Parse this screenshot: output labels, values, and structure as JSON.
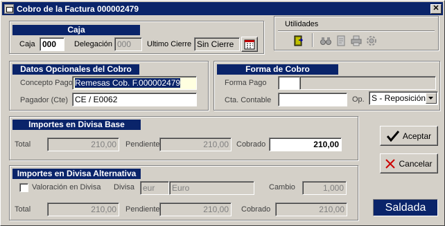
{
  "window": {
    "title": "Cobro de la Factura 000002479",
    "close_glyph": "✕"
  },
  "caja": {
    "title": "Caja",
    "caja_label": "Caja",
    "caja_value": "000",
    "delegacion_label": "Delegación",
    "delegacion_value": "000",
    "ultimo_cierre_label": "Ultimo Cierre",
    "ultimo_cierre_value": "Sin Cierre"
  },
  "utilidades": {
    "title": "Utilidades"
  },
  "datos": {
    "title": "Datos Opcionales del Cobro",
    "concepto_label": "Concepto Pago",
    "concepto_value": "Remesas Cob. F.000002479",
    "pagador_label": "Pagador (Cte)",
    "pagador_value": "CE / E0062"
  },
  "forma": {
    "title": "Forma de Cobro",
    "forma_pago_label": "Forma Pago",
    "forma_pago_code": "",
    "forma_pago_desc": "",
    "cta_contable_label": "Cta. Contable",
    "cta_contable_value": "",
    "op_label": "Op.",
    "op_value": "S - Reposición"
  },
  "base": {
    "title": "Importes en Divisa Base",
    "total_label": "Total",
    "total_value": "210,00",
    "pendiente_label": "Pendiente",
    "pendiente_value": "210,00",
    "cobrado_label": "Cobrado",
    "cobrado_value": "210,00"
  },
  "alt": {
    "title": "Importes en Divisa Alternativa",
    "valoracion_label": "Valoración en Divisa",
    "valoracion_checked": false,
    "divisa_label": "Divisa",
    "divisa_code": "eur",
    "divisa_name": "Euro",
    "cambio_label": "Cambio",
    "cambio_value": "1,000",
    "total_label": "Total",
    "total_value": "210,00",
    "pendiente_label": "Pendiente",
    "pendiente_value": "210,00",
    "cobrado_label": "Cobrado",
    "cobrado_value": "210,00"
  },
  "buttons": {
    "aceptar_label": "Aceptar",
    "cancelar_label": "Cancelar"
  },
  "status": {
    "label": "Saldada"
  },
  "colors": {
    "title_bar": "#0a246a",
    "face": "#d4d0c8",
    "check": "#000000",
    "cancel_x": "#cc0000"
  }
}
